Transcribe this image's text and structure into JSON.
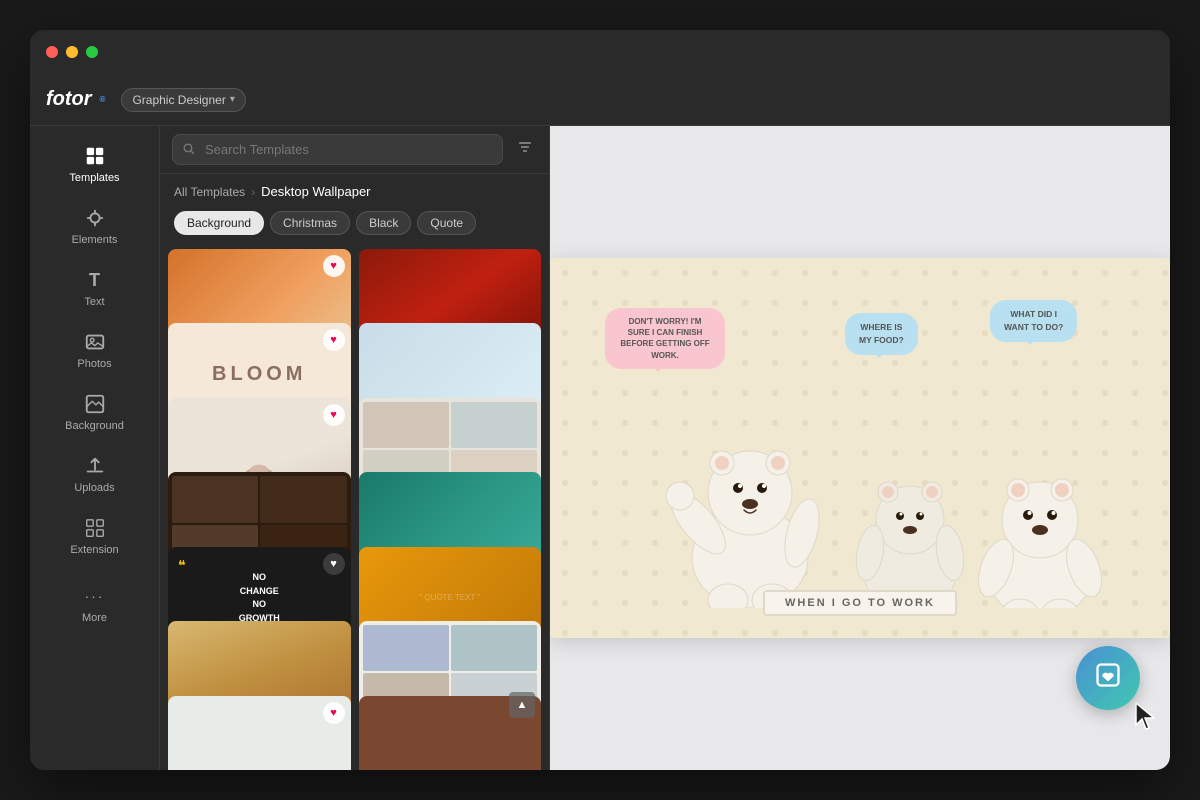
{
  "window": {
    "title": "Fotor Graphic Designer",
    "buttons": [
      "close",
      "minimize",
      "maximize"
    ]
  },
  "header": {
    "logo": "fotor",
    "mode_label": "Graphic Designer",
    "mode_chevron": "▾"
  },
  "sidebar": {
    "items": [
      {
        "id": "templates",
        "label": "Templates",
        "icon": "⊞",
        "active": true
      },
      {
        "id": "elements",
        "label": "Elements",
        "icon": "✦",
        "active": false
      },
      {
        "id": "text",
        "label": "Text",
        "icon": "T",
        "active": false
      },
      {
        "id": "photos",
        "label": "Photos",
        "icon": "⊡",
        "active": false
      },
      {
        "id": "background",
        "label": "Background",
        "icon": "◩",
        "active": false
      },
      {
        "id": "uploads",
        "label": "Uploads",
        "icon": "⬆",
        "active": false
      },
      {
        "id": "extension",
        "label": "Extension",
        "icon": "⊞",
        "active": false
      },
      {
        "id": "more",
        "label": "More",
        "icon": "···",
        "active": false
      }
    ]
  },
  "search": {
    "placeholder": "Search Templates",
    "value": ""
  },
  "breadcrumb": {
    "parent": "All Templates",
    "separator": "›",
    "current": "Desktop Wallpaper"
  },
  "filter_tags": [
    {
      "label": "Background",
      "active": true
    },
    {
      "label": "Christmas",
      "active": false
    },
    {
      "label": "Black",
      "active": false
    },
    {
      "label": "Quote",
      "active": false
    }
  ],
  "canvas": {
    "bg_color": "#f0e8d0",
    "speech_bubble_left": "DON'T WORRY!\nI'M SURE I CAN FINISH BEFORE\nGETTING OFF WORK.",
    "speech_bubble_mid": "WHERE IS\nMY FOOD?",
    "speech_bubble_right": "WHAT DID I\nWANT TO DO?",
    "bottom_banner": "WHEN I GO TO WORK"
  },
  "fab": {
    "icon": "♡",
    "label": "favorite"
  },
  "template_cards": [
    {
      "id": 1,
      "style": "warm-gradient",
      "has_heart": true
    },
    {
      "id": 2,
      "style": "red-dark",
      "has_heart": false
    },
    {
      "id": 3,
      "style": "bloom-beige",
      "text": "BLOOM",
      "has_heart": true
    },
    {
      "id": 4,
      "style": "light-blue",
      "has_heart": false
    },
    {
      "id": 5,
      "style": "beige",
      "has_heart": true
    },
    {
      "id": 6,
      "style": "collage-light",
      "has_heart": false
    },
    {
      "id": 7,
      "style": "dark-collage",
      "has_heart": false
    },
    {
      "id": 8,
      "style": "teal",
      "has_heart": false
    },
    {
      "id": 9,
      "style": "quote-black",
      "text": "NO\nCHANGE\nNO\nGROWTH",
      "has_heart": true
    },
    {
      "id": 10,
      "style": "orange-warm",
      "has_heart": false
    },
    {
      "id": 11,
      "style": "sand-landscape",
      "has_heart": false
    },
    {
      "id": 12,
      "style": "collage2",
      "has_heart": false
    },
    {
      "id": 13,
      "style": "multi-photo",
      "has_heart": true
    },
    {
      "id": 14,
      "style": "brown-bottom",
      "has_heart": false
    }
  ]
}
